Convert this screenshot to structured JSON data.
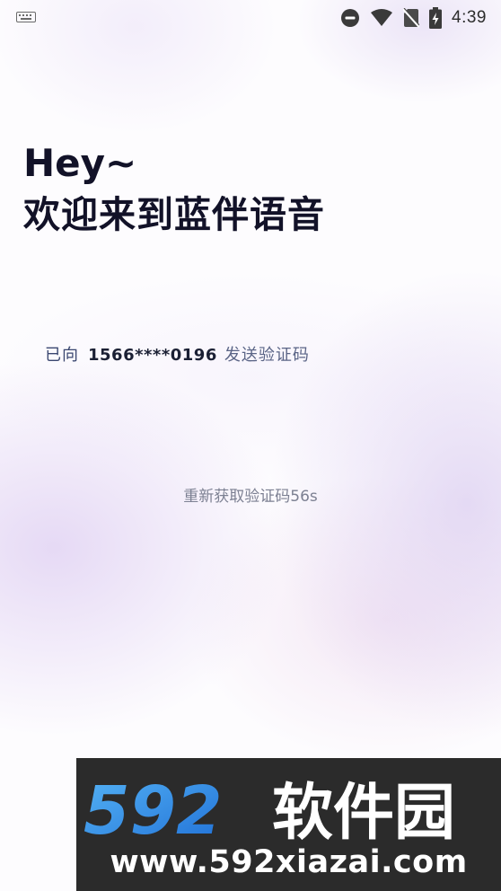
{
  "status_bar": {
    "time": "4:39",
    "icons": [
      "keyboard-icon",
      "do-not-disturb-icon",
      "wifi-icon",
      "no-sim-icon",
      "battery-charging-icon"
    ]
  },
  "headline": {
    "greeting": "Hey~",
    "welcome": "欢迎来到蓝伴语音"
  },
  "verification": {
    "sent_prefix": "已向",
    "phone": "1566****0196",
    "sent_suffix": "发送验证码",
    "resend_label": "重新获取验证码56s"
  },
  "watermark": {
    "brand": "592软件园",
    "url": "www.592xiazai.com"
  },
  "colors": {
    "headline": "#121228",
    "resend_text": "#7c8092",
    "watermark_bg": "#2b2b2b",
    "watermark_blue": "#2f8fe8"
  }
}
